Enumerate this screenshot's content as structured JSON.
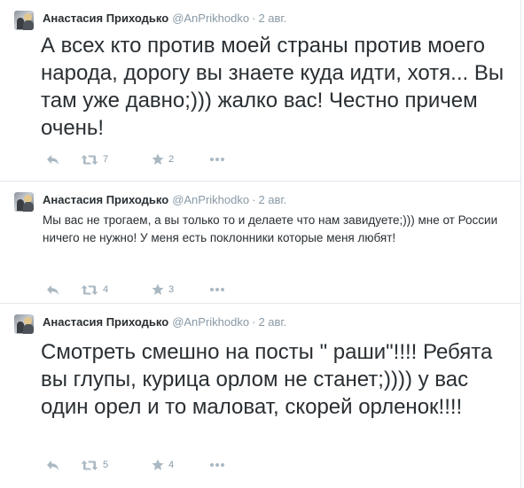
{
  "tweets": [
    {
      "fullname": "Анастасия Приходько",
      "screen_name": "@AnPrikhodko",
      "separator": "·",
      "time": "2 авг.",
      "text": "А всех кто против моей страны против моего народа, дорогу вы знаете куда идти, хотя... Вы там уже давно;))) жалко вас! Честно причем очень!",
      "retweet_count": "7",
      "favorite_count": "2",
      "icons": [
        "reply-icon",
        "retweet-icon",
        "favorite-star-icon",
        "more-dots-icon"
      ]
    },
    {
      "fullname": "Анастасия Приходько",
      "screen_name": "@AnPrikhodko",
      "separator": "·",
      "time": "2 авг.",
      "text": "Мы вас не трогаем, а вы только то и делаете что нам завидуете;))) мне от России ничего не нужно! У меня есть поклонники которые меня любят!",
      "retweet_count": "4",
      "favorite_count": "3",
      "icons": [
        "reply-icon",
        "retweet-icon",
        "favorite-star-icon",
        "more-dots-icon"
      ]
    },
    {
      "fullname": "Анастасия Приходько",
      "screen_name": "@AnPrikhodko",
      "separator": "·",
      "time": "2 авг.",
      "text": "Смотреть смешно на посты \" раши\"!!!! Ребята вы глупы, курица орлом не станет;)))) у вас один орел и то маловат, скорей орленок!!!!",
      "retweet_count": "5",
      "favorite_count": "4",
      "icons": [
        "reply-icon",
        "retweet-icon",
        "favorite-star-icon",
        "more-dots-icon"
      ]
    }
  ],
  "colors": {
    "text": "#292f33",
    "muted": "#8899a6",
    "icon": "#aab8c2",
    "divider": "#e1e8ed"
  }
}
